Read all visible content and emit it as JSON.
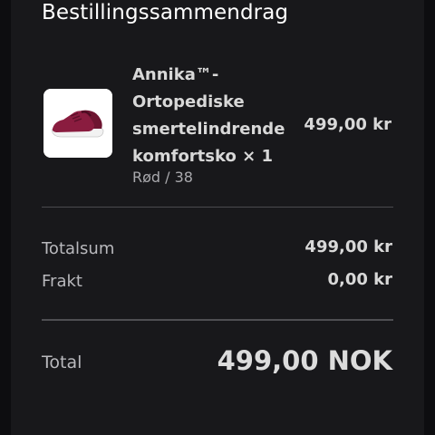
{
  "summary": {
    "title": "Bestillingssammendrag"
  },
  "product": {
    "name": "Annika™-\nOrtopediske\nsmertelindrende\nkomfortsko × 1",
    "variant": "Rød / 38",
    "price": "499,00 kr",
    "image_icon": "sneaker-image"
  },
  "totals": {
    "subtotal_label": "Totalsum",
    "subtotal_value": "499,00 kr",
    "shipping_label": "Frakt",
    "shipping_value": "0,00 kr",
    "total_label": "Total",
    "total_value": "499,00 NOK"
  },
  "colors": {
    "background": "#18181b",
    "shoe": "#8a1c3f"
  }
}
